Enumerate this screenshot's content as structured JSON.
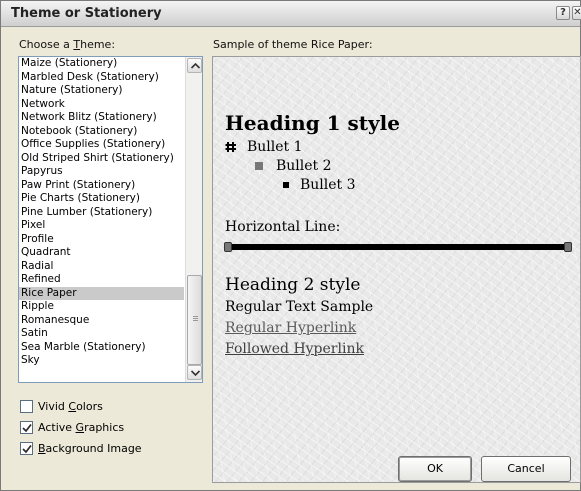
{
  "window": {
    "title": "Theme or Stationery",
    "help_label": "?",
    "close_label": "✕"
  },
  "theme_panel": {
    "label_prefix": "Choose a ",
    "label_accel": "T",
    "label_suffix": "heme:",
    "items": [
      {
        "label": "Maize (Stationery)"
      },
      {
        "label": "Marbled Desk (Stationery)"
      },
      {
        "label": "Nature (Stationery)"
      },
      {
        "label": "Network"
      },
      {
        "label": "Network Blitz (Stationery)"
      },
      {
        "label": "Notebook (Stationery)"
      },
      {
        "label": "Office Supplies (Stationery)"
      },
      {
        "label": "Old Striped Shirt (Stationery)"
      },
      {
        "label": "Papyrus"
      },
      {
        "label": "Paw Print (Stationery)"
      },
      {
        "label": "Pie Charts (Stationery)"
      },
      {
        "label": "Pine Lumber (Stationery)"
      },
      {
        "label": "Pixel"
      },
      {
        "label": "Profile"
      },
      {
        "label": "Quadrant"
      },
      {
        "label": "Radial"
      },
      {
        "label": "Refined"
      },
      {
        "label": "Rice Paper"
      },
      {
        "label": "Ripple"
      },
      {
        "label": "Romanesque"
      },
      {
        "label": "Satin"
      },
      {
        "label": "Sea Marble (Stationery)"
      },
      {
        "label": "Sky"
      }
    ],
    "selected": "Rice Paper"
  },
  "options": {
    "vivid_colors": {
      "pre": "Vivid ",
      "accel": "C",
      "post": "olors",
      "checked": false
    },
    "active_graphics": {
      "pre": "Active ",
      "accel": "G",
      "post": "raphics",
      "checked": true
    },
    "background_image": {
      "pre": "",
      "accel": "B",
      "post": "ackground Image",
      "checked": true
    }
  },
  "preview": {
    "label": "Sample of theme Rice Paper:",
    "heading1": "Heading 1 style",
    "bullet1": "Bullet 1",
    "bullet2": "Bullet 2",
    "bullet3": "Bullet 3",
    "hline_label": "Horizontal Line:",
    "heading2": "Heading 2 style",
    "regular_text": "Regular Text Sample",
    "hyperlink": "Regular Hyperlink",
    "followed_hyperlink": "Followed Hyperlink"
  },
  "buttons": {
    "ok": "OK",
    "cancel": "Cancel"
  }
}
